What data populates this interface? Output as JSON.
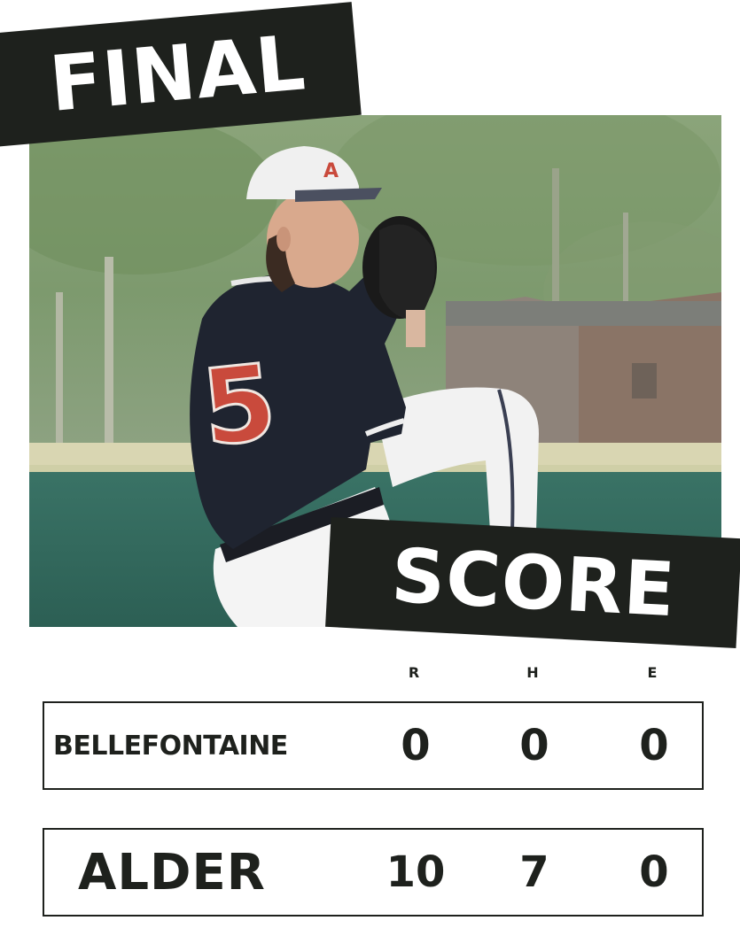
{
  "banners": {
    "top": "FINAL",
    "bottom": "SCORE"
  },
  "photo": {
    "subject": "baseball pitcher mid wind-up",
    "jersey_number": "5"
  },
  "scoreboard": {
    "columns": [
      "R",
      "H",
      "E"
    ],
    "rows": [
      {
        "team": "BELLEFONTAINE",
        "R": "0",
        "H": "0",
        "E": "0"
      },
      {
        "team": "ALDER",
        "R": "10",
        "H": "7",
        "E": "0"
      }
    ]
  },
  "colors": {
    "banner_bg": "#1e211d",
    "banner_text": "#ffffff",
    "jersey": "#1f2430",
    "jersey_number": "#c94a3c",
    "field_wall": "#2f6b5f"
  }
}
